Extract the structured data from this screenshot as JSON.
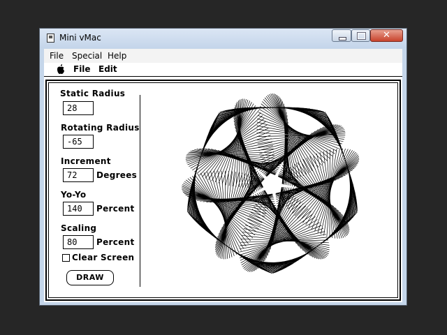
{
  "window": {
    "title": "Mini vMac",
    "close_symbol": "✕"
  },
  "host_menu": [
    "File",
    "Special",
    "Help"
  ],
  "mac_menu": {
    "apple_icon": "apple-icon",
    "items": [
      "File",
      "Edit"
    ]
  },
  "form": {
    "static_radius": {
      "label": "Static Radius",
      "value": "28"
    },
    "rotating_radius": {
      "label": "Rotating Radius",
      "value": "-65"
    },
    "increment": {
      "label": "Increment",
      "value": "72",
      "unit": "Degrees"
    },
    "yoyo": {
      "label": "Yo-Yo",
      "value": "140",
      "unit": "Percent"
    },
    "scaling": {
      "label": "Scaling",
      "value": "80",
      "unit": "Percent"
    },
    "clear_screen": {
      "label": "Clear Screen",
      "checked": false
    },
    "draw_label": "DRAW"
  },
  "colors": {
    "desktop": "#262626",
    "window_frame": "#c5d6ea",
    "close_button": "#c8432c"
  }
}
